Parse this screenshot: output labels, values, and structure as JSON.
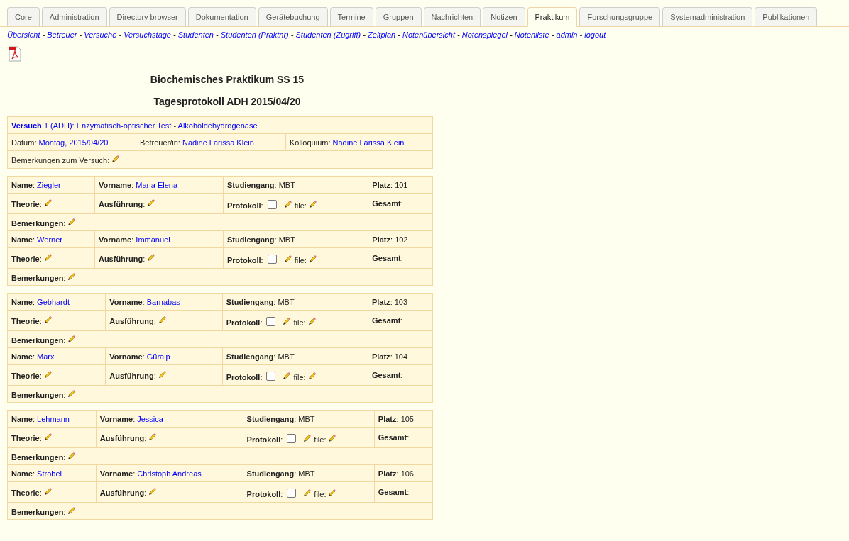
{
  "tabs": [
    {
      "label": "Core",
      "selected": false
    },
    {
      "label": "Administration",
      "selected": false
    },
    {
      "label": "Directory browser",
      "selected": false
    },
    {
      "label": "Dokumentation",
      "selected": false
    },
    {
      "label": "Gerätebuchung",
      "selected": false
    },
    {
      "label": "Termine",
      "selected": false
    },
    {
      "label": "Gruppen",
      "selected": false
    },
    {
      "label": "Nachrichten",
      "selected": false
    },
    {
      "label": "Notizen",
      "selected": false
    },
    {
      "label": "Praktikum",
      "selected": true
    },
    {
      "label": "Forschungsgruppe",
      "selected": false
    },
    {
      "label": "Systemadministration",
      "selected": false
    },
    {
      "label": "Publikationen",
      "selected": false
    }
  ],
  "nav": {
    "separator": "-",
    "links": [
      "Übersicht",
      "Betreuer",
      "Versuche",
      "Versuchstage",
      "Studenten",
      "Studenten (Praktnr)",
      "Studenten (Zugriff)",
      "Zeitplan",
      "Notenübersicht",
      "Notenspiegel",
      "Notenliste",
      "admin",
      "logout"
    ]
  },
  "title": "Biochemisches Praktikum SS 15",
  "subtitle": "Tagesprotokoll ADH 2015/04/20",
  "versuch": {
    "label": "Versuch",
    "number": "1 (ADH): Enzymatisch-optischer Test",
    "separator": "-",
    "name": "Alkoholdehydrogenase",
    "datum_label": "Datum:",
    "datum": "Montag, 2015/04/20",
    "betreuer_label": "Betreuer/in:",
    "betreuer": "Nadine Larissa Klein",
    "kolloquium_label": "Kolloquium:",
    "kolloquium": "Nadine Larissa Klein",
    "bemerkungen_label": "Bemerkungen zum Versuch:"
  },
  "groups": [
    {
      "students": [
        {
          "name_label": "**Name**:",
          "name": "Ziegler",
          "vorname_label": "**Vorname**:",
          "vorname": "Maria Elena",
          "studiengang_label": "**Studiengang**:",
          "studiengang": "MBT",
          "platz_label": "**Platz**:",
          "platz": "101",
          "theorie_label": "**Theorie**:",
          "ausfuehrung_label": "**Ausführung**:",
          "protokoll_label": "Protokoll:",
          "protokoll_checked": false,
          "file_label": "file:",
          "gesamt_label": "**Gesamt**:",
          "bemerkungen_label": "**Bemerkungen**:"
        },
        {
          "name_label": "**Name**:",
          "name": "Werner",
          "vorname_label": "**Vorname**:",
          "vorname": "Immanuel",
          "studiengang_label": "**Studiengang**:",
          "studiengang": "MBT",
          "platz_label": "**Platz**:",
          "platz": "102",
          "theorie_label": "**Theorie**:",
          "ausfuehrung_label": "**Ausführung**:",
          "protokoll_label": "Protokoll:",
          "protokoll_checked": false,
          "file_label": "file:",
          "gesamt_label": "**Gesamt**:",
          "bemerkungen_label": "**Bemerkungen**:"
        }
      ]
    },
    {
      "students": [
        {
          "name_label": "**Name**:",
          "name": "Gebhardt",
          "vorname_label": "**Vorname**:",
          "vorname": "Barnabas",
          "studiengang_label": "**Studiengang**:",
          "studiengang": "MBT",
          "platz_label": "**Platz**:",
          "platz": "103",
          "theorie_label": "**Theorie**:",
          "ausfuehrung_label": "**Ausführung**:",
          "protokoll_label": "Protokoll:",
          "protokoll_checked": false,
          "file_label": "file:",
          "gesamt_label": "**Gesamt**:",
          "bemerkungen_label": "**Bemerkungen**:"
        },
        {
          "name_label": "**Name**:",
          "name": "Marx",
          "vorname_label": "**Vorname**:",
          "vorname": "Güralp",
          "studiengang_label": "**Studiengang**:",
          "studiengang": "MBT",
          "platz_label": "**Platz**:",
          "platz": "104",
          "theorie_label": "**Theorie**:",
          "ausfuehrung_label": "**Ausführung**:",
          "protokoll_label": "Protokoll:",
          "protokoll_checked": false,
          "file_label": "file:",
          "gesamt_label": "**Gesamt**:",
          "bemerkungen_label": "**Bemerkungen**:"
        }
      ]
    },
    {
      "students": [
        {
          "name_label": "**Name**:",
          "name": "Lehmann",
          "vorname_label": "**Vorname**:",
          "vorname": "Jessica",
          "studiengang_label": "**Studiengang**:",
          "studiengang": "MBT",
          "platz_label": "**Platz**:",
          "platz": "105",
          "theorie_label": "**Theorie**:",
          "ausfuehrung_label": "**Ausführung**:",
          "protokoll_label": "Protokoll:",
          "protokoll_checked": false,
          "file_label": "file:",
          "gesamt_label": "**Gesamt**:",
          "bemerkungen_label": "**Bemerkungen**:"
        },
        {
          "name_label": "**Name**:",
          "name": "Strobel",
          "vorname_label": "**Vorname**:",
          "vorname": "Christoph Andreas",
          "studiengang_label": "**Studiengang**:",
          "studiengang": "MBT",
          "platz_label": "**Platz**:",
          "platz": "106",
          "theorie_label": "**Theorie**:",
          "ausfuehrung_label": "**Ausführung**:",
          "protokoll_label": "Protokoll:",
          "protokoll_checked": false,
          "file_label": "file:",
          "gesamt_label": "**Gesamt**:",
          "bemerkungen_label": "**Bemerkungen**:"
        }
      ]
    }
  ]
}
